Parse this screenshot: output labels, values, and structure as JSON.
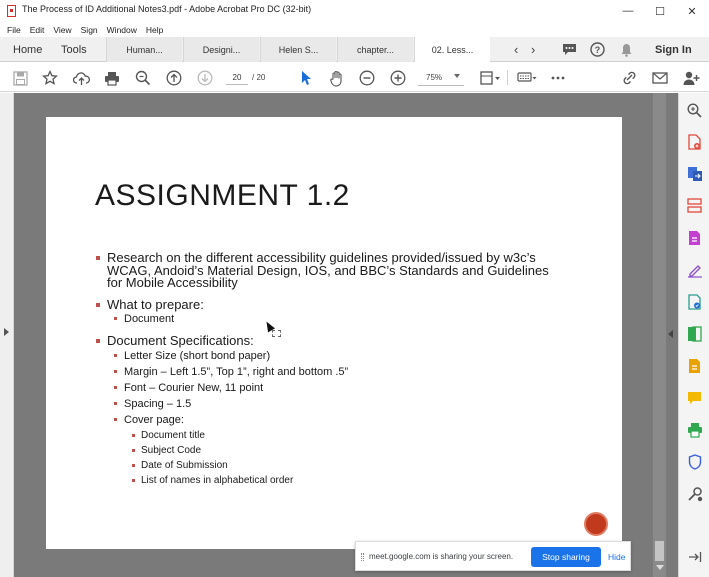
{
  "window": {
    "title": "The Process of ID Additional Notes3.pdf - Adobe Acrobat Pro DC (32-bit)",
    "minimize": "—",
    "maximize": "☐",
    "close": "✕"
  },
  "menu": [
    "File",
    "Edit",
    "View",
    "Sign",
    "Window",
    "Help"
  ],
  "tabs": {
    "home": "Home",
    "tools": "Tools",
    "documents": [
      "Human...",
      "Designi...",
      "Helen S...",
      "chapter...",
      "02. Less..."
    ],
    "sign_in": "Sign In"
  },
  "toolbar": {
    "current_page": "20",
    "total_pages": "/ 20",
    "zoom": "75%"
  },
  "slide": {
    "title": "ASSIGNMENT 1.2",
    "bullet1": "Research on the different accessibility guidelines provided/issued by w3c’s WCAG, Andoid’s Material Design, IOS,  and BBC’s Standards and Guidelines for Mobile Accessibility",
    "bullet2": "What to prepare:",
    "bullet2_sub": "Document",
    "bullet3": "Document Specifications:",
    "specs": [
      "Letter Size (short bond paper)",
      "Margin – Left 1.5”, Top 1”, right and bottom .5”",
      "Font – Courier New, 11 point",
      "Spacing – 1.5",
      "Cover page:"
    ],
    "cover_items": [
      "Document title",
      "Subject Code",
      "Date of Submission",
      "List of names in alphabetical order"
    ]
  },
  "share_banner": {
    "message": "meet.google.com is sharing your screen.",
    "stop": "Stop sharing",
    "hide": "Hide"
  },
  "colors": {
    "bullet": "#c0504d",
    "accent_blue": "#1a73e8",
    "acrobat_red": "#d32f2f"
  }
}
